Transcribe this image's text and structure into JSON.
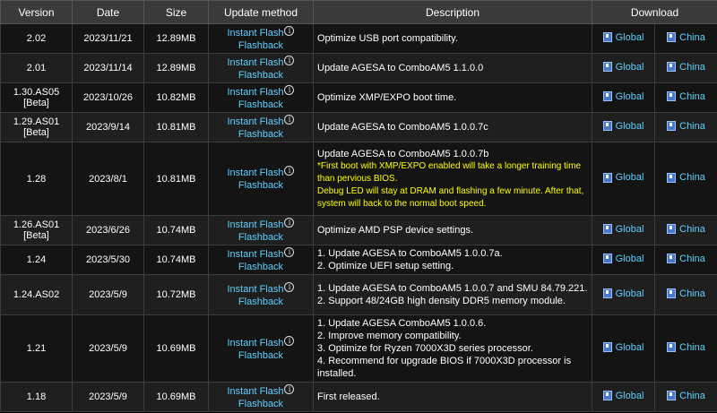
{
  "headers": {
    "version": "Version",
    "date": "Date",
    "size": "Size",
    "method": "Update method",
    "description": "Description",
    "download": "Download"
  },
  "method": {
    "line1": "Instant Flash",
    "line2": "Flashback",
    "info_symbol": "i"
  },
  "download": {
    "global": "Global",
    "china": "China"
  },
  "rows": [
    {
      "version": "2.02",
      "version2": "",
      "date": "2023/11/21",
      "size": "12.89MB",
      "desc": [
        "Optimize USB port compatibility."
      ],
      "warn": []
    },
    {
      "version": "2.01",
      "version2": "",
      "date": "2023/11/14",
      "size": "12.89MB",
      "desc": [
        "Update AGESA to ComboAM5 1.1.0.0"
      ],
      "warn": []
    },
    {
      "version": "1.30.AS05",
      "version2": "[Beta]",
      "date": "2023/10/26",
      "size": "10.82MB",
      "desc": [
        "Optimize XMP/EXPO boot time."
      ],
      "warn": []
    },
    {
      "version": "1.29.AS01",
      "version2": "[Beta]",
      "date": "2023/9/14",
      "size": "10.81MB",
      "desc": [
        "Update AGESA to ComboAM5 1.0.0.7c"
      ],
      "warn": []
    },
    {
      "version": "1.28",
      "version2": "",
      "date": "2023/8/1",
      "size": "10.81MB",
      "desc": [
        "Update AGESA to ComboAM5 1.0.0.7b"
      ],
      "warn": [
        "*First boot with XMP/EXPO enabled will take a longer training time than pervious BIOS.",
        "Debug LED will stay at DRAM and flashing a few minute. After that, system will back to the normal boot speed."
      ]
    },
    {
      "version": "1.26.AS01",
      "version2": "[Beta]",
      "date": "2023/6/26",
      "size": "10.74MB",
      "desc": [
        "Optimize AMD PSP device settings."
      ],
      "warn": []
    },
    {
      "version": "1.24",
      "version2": "",
      "date": "2023/5/30",
      "size": "10.74MB",
      "desc": [
        "1. Update AGESA to ComboAM5 1.0.0.7a.",
        "2. Optimize UEFI setup setting."
      ],
      "warn": []
    },
    {
      "version": "1.24.AS02",
      "version2": "",
      "date": "2023/5/9",
      "size": "10.72MB",
      "desc": [
        "1. Update AGESA to ComboAM5 1.0.0.7 and SMU 84.79.221.",
        "2. Support 48/24GB high density DDR5 memory module."
      ],
      "warn": []
    },
    {
      "version": "1.21",
      "version2": "",
      "date": "2023/5/9",
      "size": "10.69MB",
      "desc": [
        "1. Update AGESA ComboAM5 1.0.0.6.",
        "2. Improve memory compatibility.",
        "3. Optimize for Ryzen 7000X3D series processor.",
        "4. Recommend for upgrade BIOS if 7000X3D processor is installed."
      ],
      "warn": []
    },
    {
      "version": "1.18",
      "version2": "",
      "date": "2023/5/9",
      "size": "10.69MB",
      "desc": [
        "First released."
      ],
      "warn": []
    }
  ],
  "colors": {
    "header_bg": "#3a3a3a",
    "row_bg_odd": "#141414",
    "row_bg_even": "#1f1f1f",
    "link": "#5fd0ff",
    "warning": "#ffff00"
  }
}
